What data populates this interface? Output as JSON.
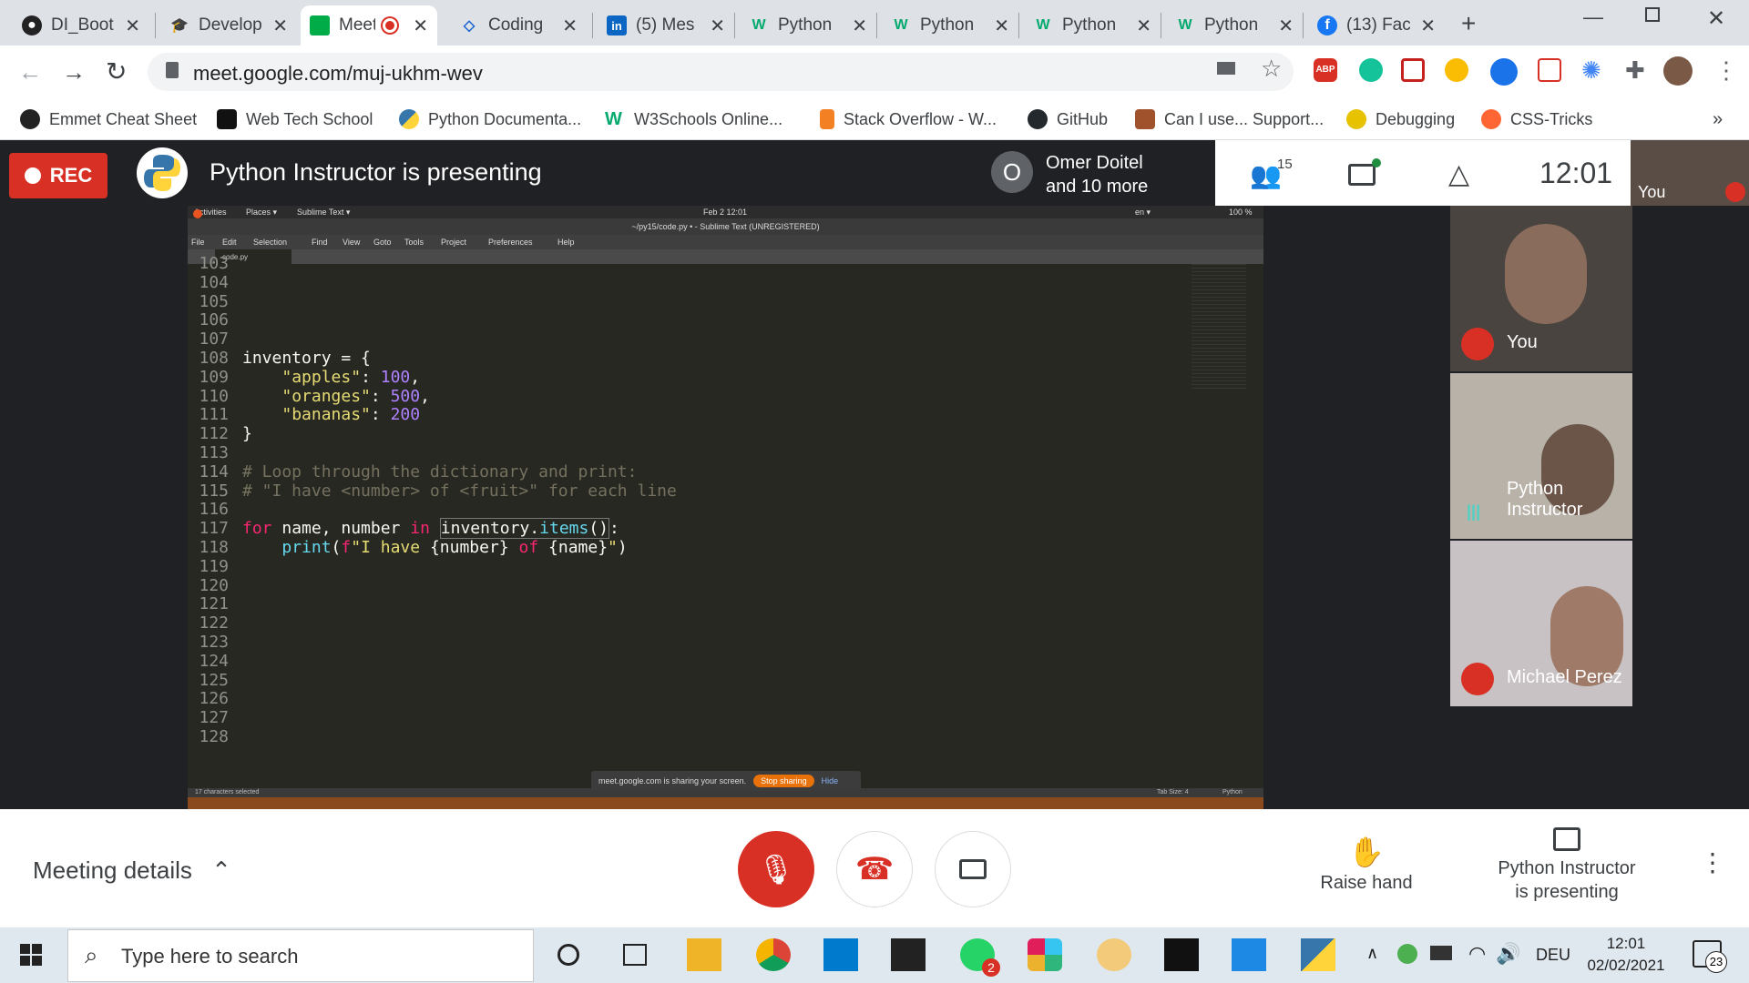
{
  "browser": {
    "tabs": [
      {
        "label": "DI_Boot",
        "icon": "github-icon"
      },
      {
        "label": "Develop",
        "icon": "graduation-cap-icon"
      },
      {
        "label": "Meet",
        "icon": "google-meet-icon",
        "active": true
      },
      {
        "label": "Coding",
        "icon": "codepen-icon"
      },
      {
        "label": "(5) Mes",
        "icon": "linkedin-icon"
      },
      {
        "label": "Python",
        "icon": "w3schools-icon"
      },
      {
        "label": "Python",
        "icon": "w3schools-icon"
      },
      {
        "label": "Python",
        "icon": "w3schools-icon"
      },
      {
        "label": "Python",
        "icon": "w3schools-icon"
      },
      {
        "label": "(13) Fac",
        "icon": "facebook-icon"
      }
    ],
    "url": "meet.google.com/muj-ukhm-wev",
    "bookmarks": [
      {
        "label": "Emmet Cheat Sheet",
        "color": "#222"
      },
      {
        "label": "Web Tech School",
        "color": "#111"
      },
      {
        "label": "Python Documenta...",
        "color": "#3776ab"
      },
      {
        "label": "W3Schools Online...",
        "color": "#04aa6d"
      },
      {
        "label": "Stack Overflow - W...",
        "color": "#f48024"
      },
      {
        "label": "GitHub",
        "color": "#24292e"
      },
      {
        "label": "Can I use... Support...",
        "color": "#a0522d"
      },
      {
        "label": "Debugging",
        "color": "#e6c200"
      },
      {
        "label": "CSS-Tricks",
        "color": "#ff6633"
      }
    ]
  },
  "meet": {
    "rec_label": "REC",
    "presenting_title": "Python Instructor is presenting",
    "participant_avatar_letter": "O",
    "participant_names": "Omer Doitel\nand 10 more",
    "participant_count": "15",
    "clock": "12:01",
    "self_preview_label": "You",
    "tiles": [
      {
        "name": "You",
        "muted": true
      },
      {
        "name": "Python Instructor",
        "muted": false
      },
      {
        "name": "Michael Perez",
        "muted": true
      }
    ],
    "meeting_details_label": "Meeting details",
    "raise_hand_label": "Raise hand",
    "presenting_label": "Python Instructor\nis presenting"
  },
  "shared_screen": {
    "topbar": {
      "activities": "Activities",
      "places": "Places ▾",
      "sublime": "Sublime Text ▾",
      "datetime": "Feb 2  12:01",
      "lang": "en ▾",
      "battery": "100 %"
    },
    "window_title": "~/py15/code.py • - Sublime Text (UNREGISTERED)",
    "menu": [
      "File",
      "Edit",
      "Selection",
      "Find",
      "View",
      "Goto",
      "Tools",
      "Project",
      "Preferences",
      "Help"
    ],
    "tab_name": "code.py",
    "line_numbers": [
      "103",
      "104",
      "105",
      "106",
      "107",
      "108",
      "109",
      "110",
      "111",
      "112",
      "113",
      "114",
      "115",
      "116",
      "117",
      "118",
      "119",
      "120",
      "121",
      "122",
      "123",
      "124",
      "125",
      "126",
      "127",
      "128"
    ],
    "status_left": "17 characters selected",
    "status_tab": "Tab Size: 4",
    "status_lang": "Python",
    "share_notice": "meet.google.com is sharing your screen.",
    "stop_sharing": "Stop sharing",
    "hide": "Hide"
  },
  "taskbar": {
    "search_placeholder": "Type here to search",
    "lang": "DEU",
    "time": "12:01",
    "date": "02/02/2021",
    "notification_count": "23",
    "whatsapp_badge": "2"
  }
}
